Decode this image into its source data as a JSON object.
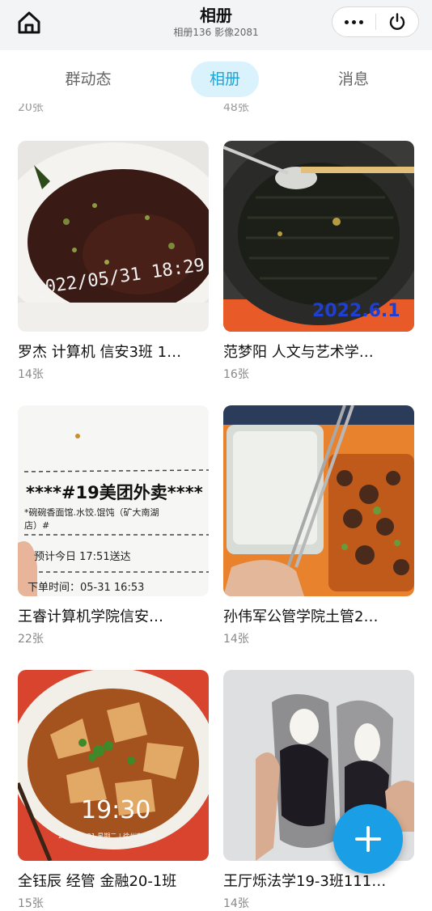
{
  "header": {
    "title": "相册",
    "subtitle": "相册136 影像2081"
  },
  "tabs": [
    {
      "label": "群动态"
    },
    {
      "label": "相册",
      "active": true
    },
    {
      "label": "消息"
    }
  ],
  "cutoff_counts": [
    "20张",
    "48张"
  ],
  "albums": [
    {
      "caption": "罗杰 计算机 信安3班 1…",
      "count": "14张",
      "photo_stamp": "2022/05/31 18:29",
      "icon": "soup-bowl-photo"
    },
    {
      "caption": "范梦阳 人文与艺术学…",
      "count": "16张",
      "photo_stamp": "2022.6.1",
      "icon": "grill-pan-photo"
    },
    {
      "caption": "王睿计算机学院信安…",
      "count": "22张",
      "photo_stamp": "****#19美团外卖****",
      "receipt_lines": [
        "*碗碗香面馆.水饺.馄饨（矿大南湖",
        "店）#",
        "预计今日 17:51送达",
        "下单时间：05-31 16:53"
      ],
      "icon": "receipt-photo"
    },
    {
      "caption": "孙伟军公管学院土管2…",
      "count": "14张",
      "icon": "rice-box-photo"
    },
    {
      "caption": "全钰辰 经管 金融20-1班",
      "count": "15张",
      "photo_stamp": "19:30",
      "photo_substamp": "2022.05.31 星期二 | 徐州市竹苑",
      "icon": "noodle-bowl-photo"
    },
    {
      "caption": "王厅烁法学19-3班111…",
      "count": "14张",
      "icon": "bread-photo"
    }
  ],
  "colors": {
    "accent": "#1aa6d9",
    "fab": "#1a9ee6",
    "topbar": "#f3f4f6"
  }
}
